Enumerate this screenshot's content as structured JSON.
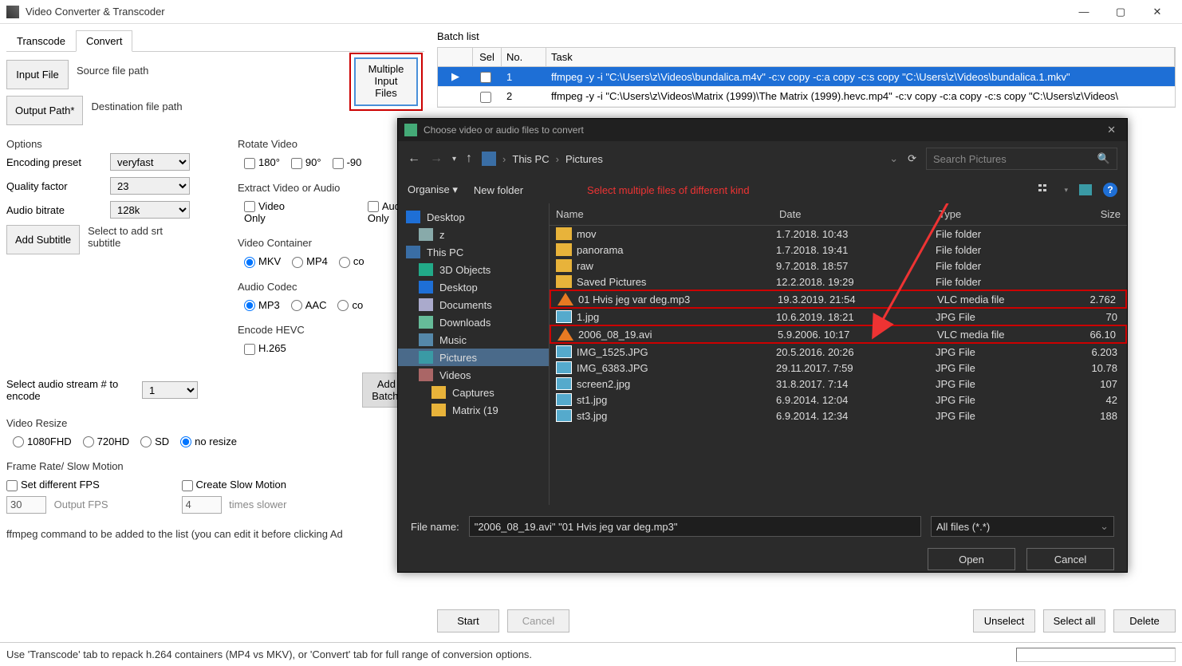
{
  "app": {
    "title": "Video Converter & Transcoder"
  },
  "window_buttons": {
    "min": "—",
    "max": "▢",
    "close": "✕"
  },
  "tabs": {
    "transcode": "Transcode",
    "convert": "Convert"
  },
  "left": {
    "input_btn": "Input File",
    "source_lbl": "Source file path",
    "output_btn": "Output Path*",
    "dest_lbl": "Destination file path",
    "multi_btn_l1": "Multiple",
    "multi_btn_l2": "Input Files",
    "rotate_hdr": "Rotate Video",
    "rot_180": "180°",
    "rot_90": "90°",
    "rot_n90": "-90",
    "extract_hdr": "Extract Video or Audio",
    "vid_only": "Video Only",
    "aud_only": "Audio Only",
    "options_hdr": "Options",
    "enc_preset": "Encoding preset",
    "enc_preset_val": "veryfast",
    "quality": "Quality factor",
    "quality_val": "23",
    "abitrate": "Audio bitrate",
    "abitrate_val": "128k",
    "add_sub": "Add Subtitle",
    "sub_hint": "Select to add srt subtitle",
    "vcont_hdr": "Video Container",
    "mkv": "MKV",
    "mp4": "MP4",
    "co": "co",
    "acodec_hdr": "Audio Codec",
    "mp3": "MP3",
    "aac": "AAC",
    "hevc_hdr": "Encode HEVC",
    "h265": "H.265",
    "aud_stream_lbl": "Select audio stream # to encode",
    "aud_stream_val": "1",
    "add_batch_l1": "Add To",
    "add_batch_l2": "Batch Lis",
    "resize_hdr": "Video Resize",
    "r1080": "1080FHD",
    "r720": "720HD",
    "rsd": "SD",
    "rno": "no resize",
    "fps_hdr": "Frame Rate/ Slow Motion",
    "set_fps": "Set different FPS",
    "fps_val": "30",
    "fps_lbl": "Output FPS",
    "slow": "Create Slow Motion",
    "slow_val": "4",
    "slow_lbl": "times slower",
    "cmd_hint": "ffmpeg command to be added to the list (you can edit it before clicking Ad"
  },
  "batch": {
    "title": "Batch list",
    "col_sel": "Sel",
    "col_no": "No.",
    "col_task": "Task",
    "row1_no": "1",
    "row1_task": "ffmpeg -y -i \"C:\\Users\\z\\Videos\\bundalica.m4v\" -c:v copy -c:a copy -c:s copy \"C:\\Users\\z\\Videos\\bundalica.1.mkv\"",
    "row2_no": "2",
    "row2_task": "ffmpeg -y -i \"C:\\Users\\z\\Videos\\Matrix (1999)\\The Matrix (1999).hevc.mp4\" -c:v copy -c:a copy -c:s copy \"C:\\Users\\z\\Videos\\",
    "start": "Start",
    "cancel": "Cancel",
    "unselect": "Unselect",
    "sel_all": "Select all",
    "delete": "Delete"
  },
  "dialog": {
    "title": "Choose video or audio files to convert",
    "crumb1": "This PC",
    "crumb2": "Pictures",
    "search_ph": "Search Pictures",
    "organise": "Organise",
    "new_folder": "New folder",
    "red_note": "Select multiple files of different kind",
    "tree": [
      "Desktop",
      "z",
      "This PC",
      "3D Objects",
      "Desktop",
      "Documents",
      "Downloads",
      "Music",
      "Pictures",
      "Videos",
      "Captures",
      "Matrix (19"
    ],
    "cols": {
      "name": "Name",
      "date": "Date",
      "type": "Type",
      "size": "Size"
    },
    "files": [
      {
        "n": "mov",
        "d": "1.7.2018. 10:43",
        "t": "File folder",
        "s": "",
        "ic": "fold"
      },
      {
        "n": "panorama",
        "d": "1.7.2018. 19:41",
        "t": "File folder",
        "s": "",
        "ic": "fold"
      },
      {
        "n": "raw",
        "d": "9.7.2018. 18:57",
        "t": "File folder",
        "s": "",
        "ic": "fold"
      },
      {
        "n": "Saved Pictures",
        "d": "12.2.2018. 19:29",
        "t": "File folder",
        "s": "",
        "ic": "fold"
      },
      {
        "n": "01 Hvis jeg var deg.mp3",
        "d": "19.3.2019. 21:54",
        "t": "VLC media file",
        "s": "2.762",
        "ic": "vlc",
        "mk": true
      },
      {
        "n": "1.jpg",
        "d": "10.6.2019. 18:21",
        "t": "JPG File",
        "s": "70",
        "ic": "img"
      },
      {
        "n": "2006_08_19.avi",
        "d": "5.9.2006. 10:17",
        "t": "VLC media file",
        "s": "66.10",
        "ic": "vlc",
        "mk": true
      },
      {
        "n": "IMG_1525.JPG",
        "d": "20.5.2016. 20:26",
        "t": "JPG File",
        "s": "6.203",
        "ic": "img"
      },
      {
        "n": "IMG_6383.JPG",
        "d": "29.11.2017. 7:59",
        "t": "JPG File",
        "s": "10.78",
        "ic": "img"
      },
      {
        "n": "screen2.jpg",
        "d": "31.8.2017. 7:14",
        "t": "JPG File",
        "s": "107",
        "ic": "img"
      },
      {
        "n": "st1.jpg",
        "d": "6.9.2014. 12:04",
        "t": "JPG File",
        "s": "42",
        "ic": "img"
      },
      {
        "n": "st3.jpg",
        "d": "6.9.2014. 12:34",
        "t": "JPG File",
        "s": "188",
        "ic": "img"
      }
    ],
    "fn_label": "File name:",
    "fn_value": "\"2006_08_19.avi\" \"01 Hvis jeg var deg.mp3\"",
    "filter": "All files (*.*)",
    "open": "Open",
    "cancel": "Cancel"
  },
  "status": "Use 'Transcode' tab to repack h.264 containers (MP4 vs MKV), or 'Convert' tab for full range of conversion options."
}
